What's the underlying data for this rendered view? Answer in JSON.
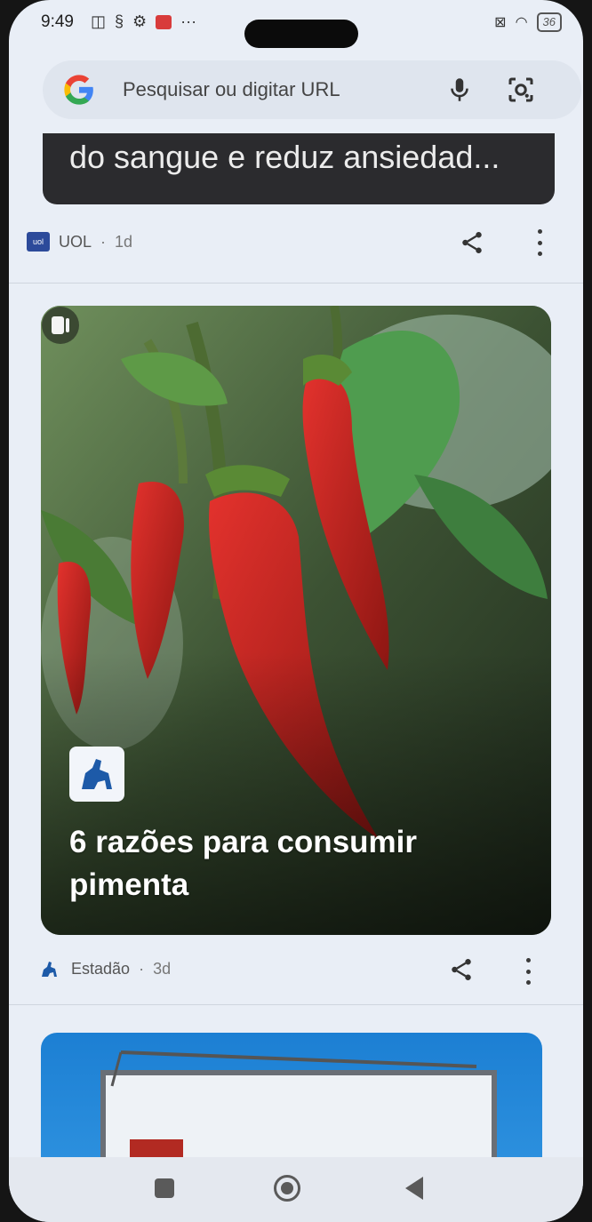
{
  "status_bar": {
    "time": "9:49",
    "battery": "36"
  },
  "search_bar": {
    "placeholder": "Pesquisar ou digitar URL"
  },
  "feed": {
    "top_card": {
      "title_fragment": "do sangue e reduz ansiedad...",
      "source": "UOL",
      "age": "1d"
    },
    "main_card": {
      "title": "6 razões para consumir pimenta",
      "source": "Estadão",
      "age": "3d"
    }
  },
  "colors": {
    "background": "#e9eef6",
    "dark_card": "#2b2b2e",
    "accent_blue": "#1c7fd3"
  },
  "icons": {
    "google": "google-logo",
    "mic": "mic-icon",
    "lens": "lens-icon",
    "share": "share-icon",
    "more": "more-vert-icon",
    "video": "video-icon"
  }
}
